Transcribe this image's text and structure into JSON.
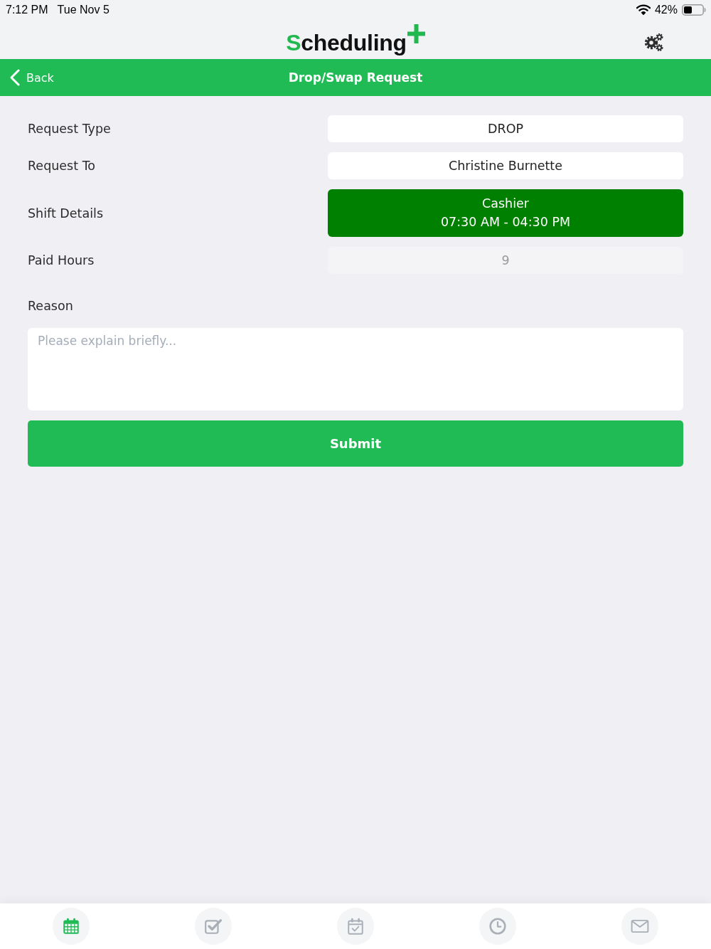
{
  "status_bar": {
    "time": "7:12 PM",
    "date": "Tue Nov 5",
    "battery": "42%"
  },
  "header": {
    "logo": "Scheduling"
  },
  "nav_bar": {
    "back": "Back",
    "title": "Drop/Swap Request"
  },
  "form": {
    "rows": [
      {
        "label": "Request Type",
        "kind": "field",
        "value": "DROP",
        "disabled": false
      },
      {
        "label": "Request To",
        "kind": "field",
        "value": "Christine Burnette",
        "disabled": false
      },
      {
        "label": "Shift Details",
        "kind": "shift",
        "lines": [
          "Cashier",
          "07:30 AM - 04:30 PM"
        ]
      },
      {
        "label": "Paid Hours",
        "kind": "field",
        "value": "9",
        "disabled": true
      }
    ],
    "reason": {
      "label": "Reason",
      "placeholder": "Please explain briefly..."
    },
    "submit": "Submit"
  },
  "tab_bar": [
    {
      "kind": "calendar",
      "selected": true
    },
    {
      "kind": "tasks",
      "selected": false
    },
    {
      "kind": "calendar-check",
      "selected": false
    },
    {
      "kind": "clock",
      "selected": false
    },
    {
      "kind": "mail",
      "selected": false
    }
  ]
}
